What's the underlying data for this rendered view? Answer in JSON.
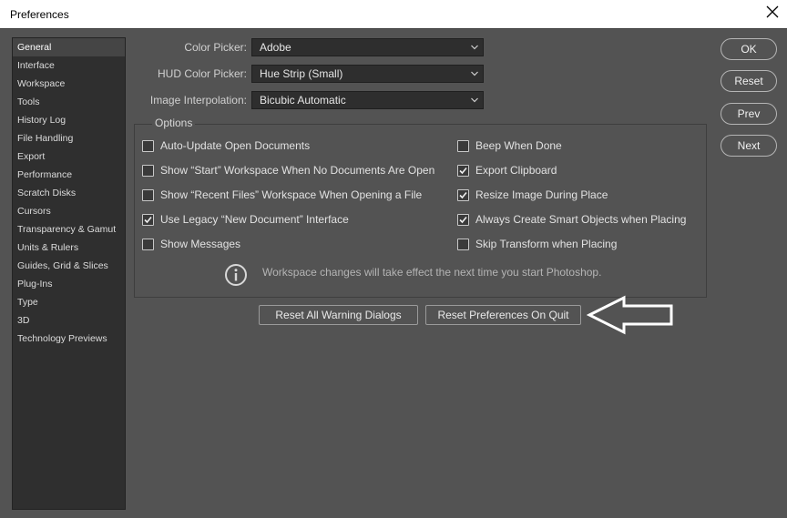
{
  "window": {
    "title": "Preferences"
  },
  "sidebar": {
    "items": [
      {
        "label": "General",
        "active": true
      },
      {
        "label": "Interface"
      },
      {
        "label": "Workspace"
      },
      {
        "label": "Tools"
      },
      {
        "label": "History Log"
      },
      {
        "label": "File Handling"
      },
      {
        "label": "Export"
      },
      {
        "label": "Performance"
      },
      {
        "label": "Scratch Disks"
      },
      {
        "label": "Cursors"
      },
      {
        "label": "Transparency & Gamut"
      },
      {
        "label": "Units & Rulers"
      },
      {
        "label": "Guides, Grid & Slices"
      },
      {
        "label": "Plug-Ins"
      },
      {
        "label": "Type"
      },
      {
        "label": "3D"
      },
      {
        "label": "Technology Previews"
      }
    ]
  },
  "form": {
    "color_picker": {
      "label": "Color Picker:",
      "value": "Adobe"
    },
    "hud_color_picker": {
      "label": "HUD Color Picker:",
      "value": "Hue Strip (Small)"
    },
    "image_interpolation": {
      "label": "Image Interpolation:",
      "value": "Bicubic Automatic"
    }
  },
  "options": {
    "legend": "Options",
    "left": [
      {
        "label": "Auto-Update Open Documents",
        "checked": false
      },
      {
        "label": "Show “Start” Workspace When No Documents Are Open",
        "checked": false
      },
      {
        "label": "Show “Recent Files” Workspace When Opening a File",
        "checked": false
      },
      {
        "label": "Use Legacy “New Document” Interface",
        "checked": true
      },
      {
        "label": "Show Messages",
        "checked": false
      }
    ],
    "right": [
      {
        "label": "Beep When Done",
        "checked": false
      },
      {
        "label": "Export Clipboard",
        "checked": true
      },
      {
        "label": "Resize Image During Place",
        "checked": true
      },
      {
        "label": "Always Create Smart Objects when Placing",
        "checked": true
      },
      {
        "label": "Skip Transform when Placing",
        "checked": false
      }
    ],
    "info_message": "Workspace changes will take effect the next time you start Photoshop."
  },
  "actions": {
    "reset_warning_dialogs": "Reset All Warning Dialogs",
    "reset_preferences_on_quit": "Reset Preferences On Quit"
  },
  "dialog_buttons": {
    "ok": "OK",
    "reset": "Reset",
    "prev": "Prev",
    "next": "Next"
  },
  "colors": {
    "panel_bg": "#535353",
    "sidebar_bg": "#2f2f2f",
    "selected_item": "#454545",
    "annotation_arrow": "#ffffff"
  },
  "icons": {
    "close": "close-icon",
    "info": "info-icon",
    "caret": "chevron-down-icon",
    "check": "checkmark-icon",
    "annotation": "arrow-left-icon"
  }
}
